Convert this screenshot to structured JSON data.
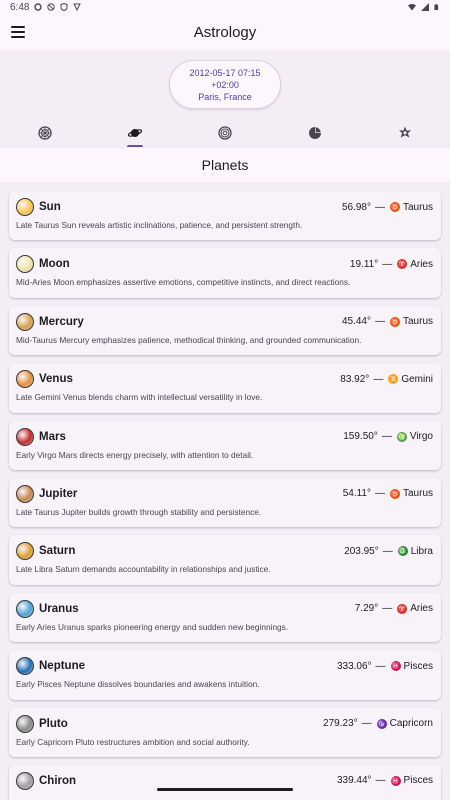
{
  "status": {
    "time": "6:48"
  },
  "app": {
    "title": "Astrology"
  },
  "chart": {
    "datetime": "2012-05-17 07:15",
    "offset": "+02:00",
    "location": "Paris, France"
  },
  "tabs": [
    {
      "icon": "zodiac-wheel-icon",
      "active": false
    },
    {
      "icon": "planet-icon",
      "active": true
    },
    {
      "icon": "houses-wheel-icon",
      "active": false
    },
    {
      "icon": "pie-chart-icon",
      "active": false
    },
    {
      "icon": "aspects-star-icon",
      "active": false
    }
  ],
  "section": {
    "title": "Planets"
  },
  "planets": [
    {
      "name": "Sun",
      "degree": "56.98°",
      "sep": "—",
      "sign": "Taurus",
      "sign_glyph": "♉",
      "sign_color": "#e65100",
      "icon_color": "#f9c74f",
      "description": "Late Taurus Sun reveals artistic inclinations, patience, and persistent strength."
    },
    {
      "name": "Moon",
      "degree": "19.11°",
      "sep": "—",
      "sign": "Aries",
      "sign_glyph": "♈",
      "sign_color": "#d32f2f",
      "icon_color": "#f3e6a6",
      "description": "Mid-Aries Moon emphasizes assertive emotions, competitive instincts, and direct reactions."
    },
    {
      "name": "Mercury",
      "degree": "45.44°",
      "sep": "—",
      "sign": "Taurus",
      "sign_glyph": "♉",
      "sign_color": "#e65100",
      "icon_color": "#d9a24a",
      "description": "Mid-Taurus Mercury emphasizes patience, methodical thinking, and grounded communication."
    },
    {
      "name": "Venus",
      "degree": "83.92°",
      "sep": "—",
      "sign": "Gemini",
      "sign_glyph": "♊",
      "sign_color": "#f9a825",
      "icon_color": "#e8913a",
      "description": "Late Gemini Venus blends charm with intellectual versatility in love."
    },
    {
      "name": "Mars",
      "degree": "159.50°",
      "sep": "—",
      "sign": "Virgo",
      "sign_glyph": "♍",
      "sign_color": "#43a047",
      "icon_color": "#c62828",
      "description": "Early Virgo Mars directs energy precisely, with attention to detail."
    },
    {
      "name": "Jupiter",
      "degree": "54.11°",
      "sep": "—",
      "sign": "Taurus",
      "sign_glyph": "♉",
      "sign_color": "#e65100",
      "icon_color": "#c8874a",
      "description": "Late Taurus Jupiter builds growth through stability and persistence."
    },
    {
      "name": "Saturn",
      "degree": "203.95°",
      "sep": "—",
      "sign": "Libra",
      "sign_glyph": "♎",
      "sign_color": "#2e7d32",
      "icon_color": "#e0a030",
      "description": "Late Libra Saturn demands accountability in relationships and justice."
    },
    {
      "name": "Uranus",
      "degree": "7.29°",
      "sep": "—",
      "sign": "Aries",
      "sign_glyph": "♈",
      "sign_color": "#d32f2f",
      "icon_color": "#4fa3d9",
      "description": "Early Aries Uranus sparks pioneering energy and sudden new beginnings."
    },
    {
      "name": "Neptune",
      "degree": "333.06°",
      "sep": "—",
      "sign": "Pisces",
      "sign_glyph": "♓",
      "sign_color": "#c2185b",
      "icon_color": "#1e6fb8",
      "description": "Early Pisces Neptune dissolves boundaries and awakens intuition."
    },
    {
      "name": "Pluto",
      "degree": "279.23°",
      "sep": "—",
      "sign": "Capricorn",
      "sign_glyph": "♑",
      "sign_color": "#7b1fa2",
      "icon_color": "#8a8a8a",
      "description": "Early Capricorn Pluto restructures ambition and social authority."
    },
    {
      "name": "Chiron",
      "degree": "339.44°",
      "sep": "—",
      "sign": "Pisces",
      "sign_glyph": "♓",
      "sign_color": "#c2185b",
      "icon_color": "#a0a0a0",
      "description": ""
    }
  ]
}
